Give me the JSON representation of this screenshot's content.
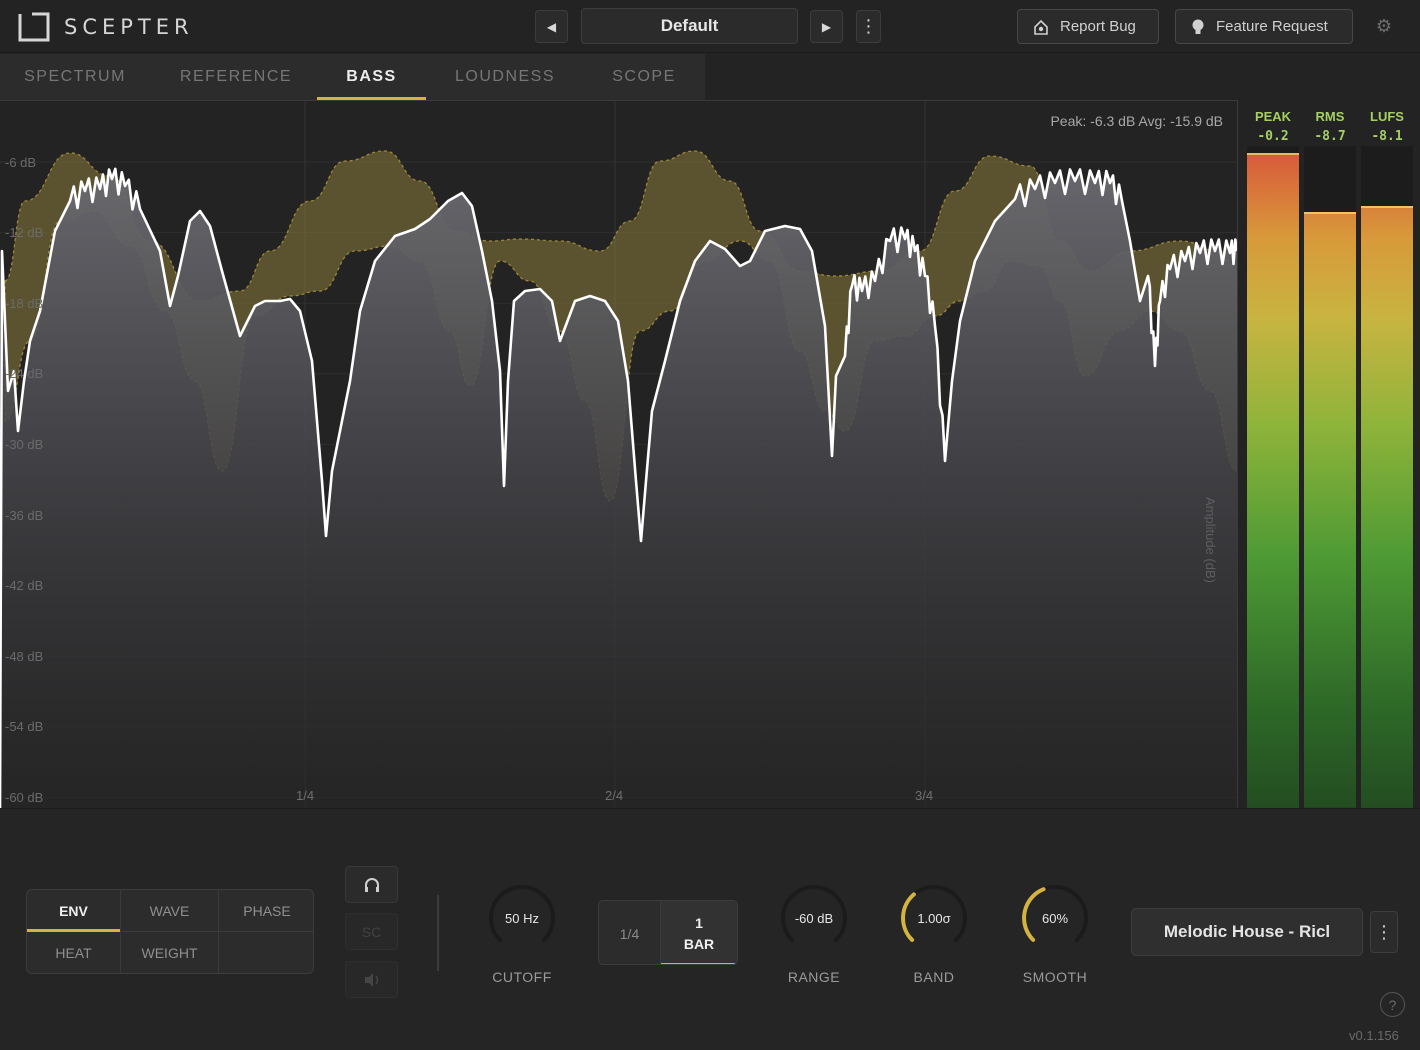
{
  "app": {
    "title": "SCEPTER"
  },
  "preset": {
    "prev_icon": "◀",
    "name": "Default",
    "next_icon": "▶",
    "menu_icon": "⋮"
  },
  "header_buttons": {
    "report_bug": "Report Bug",
    "feature_request": "Feature Request",
    "settings_icon": "gear-icon"
  },
  "tabs": [
    {
      "label": "SPECTRUM",
      "active": false
    },
    {
      "label": "REFERENCE",
      "active": false
    },
    {
      "label": "BASS",
      "active": true
    },
    {
      "label": "LOUDNESS",
      "active": false
    },
    {
      "label": "SCOPE",
      "active": false
    }
  ],
  "graph": {
    "peak_avg": "Peak: -6.3 dB  Avg: -15.9 dB",
    "y_labels": [
      "-6 dB",
      "-12 dB",
      "-18 dB",
      "-24 dB",
      "-30 dB",
      "-36 dB",
      "-42 dB",
      "-48 dB",
      "-54 dB",
      "-60 dB"
    ],
    "x_labels": [
      "1/4",
      "2/4",
      "3/4"
    ],
    "y_axis_title": "Amplitude (dB)"
  },
  "meters": [
    {
      "name": "PEAK",
      "value": "-0.2",
      "level": 0.99
    },
    {
      "name": "RMS",
      "value": "-8.7",
      "level": 0.9
    },
    {
      "name": "LUFS",
      "value": "-8.1",
      "level": 0.91
    }
  ],
  "modes": {
    "row1": [
      "ENV",
      "WAVE",
      "PHASE"
    ],
    "row2": [
      "HEAT",
      "WEIGHT"
    ],
    "active": "ENV"
  },
  "side_buttons": {
    "headphones_icon": "headphones-icon",
    "sc": "SC",
    "speaker_icon": "speaker-icon"
  },
  "knobs": {
    "cutoff": {
      "value": "50 Hz",
      "label": "CUTOFF",
      "fraction": 0.0
    },
    "range": {
      "value": "-60 dB",
      "label": "RANGE",
      "fraction": 0.0
    },
    "band": {
      "value": "1.00σ",
      "label": "BAND",
      "fraction": 0.35
    },
    "smooth": {
      "value": "60%",
      "label": "SMOOTH",
      "fraction": 0.42
    }
  },
  "bar_toggle": {
    "option1": "1/4",
    "option2_line1": "1",
    "option2_line2": "BAR"
  },
  "track": {
    "name": "Melodic House - Ricl",
    "menu_icon": "⋮"
  },
  "footer": {
    "help": "?",
    "version": "v0.1.156"
  },
  "colors": {
    "accent": "#d4b340",
    "reference_band": "#8a7a3a",
    "signal_line": "#ffffff",
    "meter_label": "#a6cf63"
  }
}
